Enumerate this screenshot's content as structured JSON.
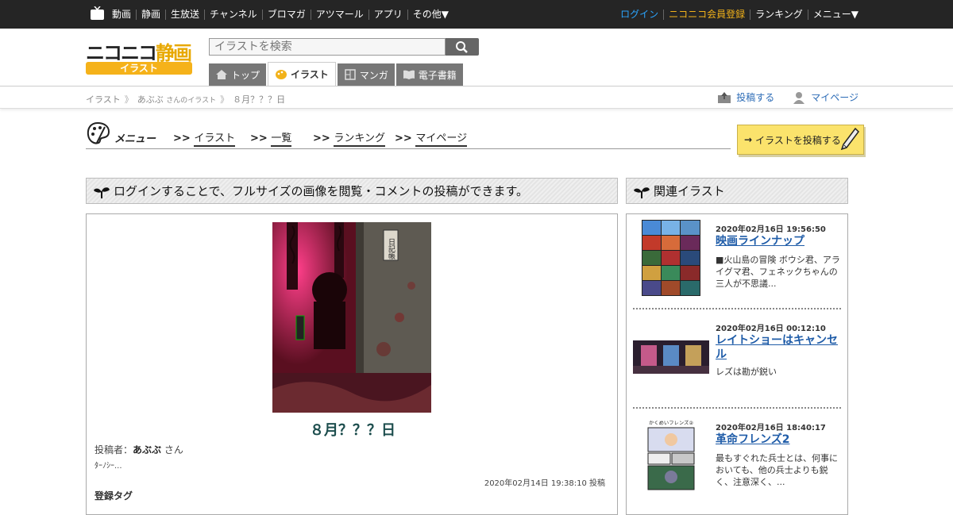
{
  "topbar": {
    "nav": [
      "動画",
      "静画",
      "生放送",
      "チャンネル",
      "ブロマガ",
      "アツマール",
      "アプリ",
      "その他▼"
    ],
    "login": "ログイン",
    "register": "ニコニコ会員登録",
    "ranking": "ランキング",
    "menu": "メニュー▼"
  },
  "header": {
    "logo_main": "ニコニコ",
    "logo_accent": "静画",
    "logo_sub": "イラスト",
    "search_placeholder": "イラストを検索",
    "tabs": [
      {
        "label": "トップ"
      },
      {
        "label": "イラスト"
      },
      {
        "label": "マンガ"
      },
      {
        "label": "電子書籍"
      }
    ]
  },
  "breadcrumb": {
    "items": [
      "イラスト",
      "あぶぶ",
      "さんのイラスト",
      "８月？？？日"
    ],
    "post_link": "投稿する",
    "mypage_link": "マイページ"
  },
  "menu": {
    "label": "メニュー",
    "items": [
      ">>",
      "イラスト",
      ">>",
      "一覧",
      ">>",
      "ランキング",
      ">>",
      "マイページ"
    ],
    "post_button": "イラストを投稿する"
  },
  "notice": "ログインすることで、フルサイズの画像を閲覧・コメントの投稿ができます。",
  "related_header": "関連イラスト",
  "illustration": {
    "title": "８月？？？日",
    "poster_label": "投稿者：",
    "poster_name": "あぶぶ",
    "poster_suffix": "さん",
    "description": "ﾀｰﾉｼｰ...",
    "posted_at": "2020年02月14日 19:38:10 投稿",
    "tags_label": "登録タグ",
    "sign_text": "日記帳"
  },
  "related": [
    {
      "date": "2020年02月16日 19:56:50",
      "title": "映画ラインナップ",
      "description": "■火山島の冒険 ボウシ君、アライグマ君、フェネックちゃんの三人が不思議..."
    },
    {
      "date": "2020年02月16日 00:12:10",
      "title": "レイトショーはキャンセル",
      "description": "レズは勘が鋭い"
    },
    {
      "date": "2020年02月16日 18:40:17",
      "title": "革命フレンズ2",
      "description": "最もすぐれた兵士とは、何事においても、他の兵士よりも鋭く、注意深く、...",
      "thumb_caption": "かくめいフレンズ②"
    }
  ],
  "colors": {
    "topbar": "#252525",
    "login": "#2ba5ff",
    "register": "#f2b21a",
    "link": "#1f5ca8",
    "title": "#1c4d4d"
  }
}
